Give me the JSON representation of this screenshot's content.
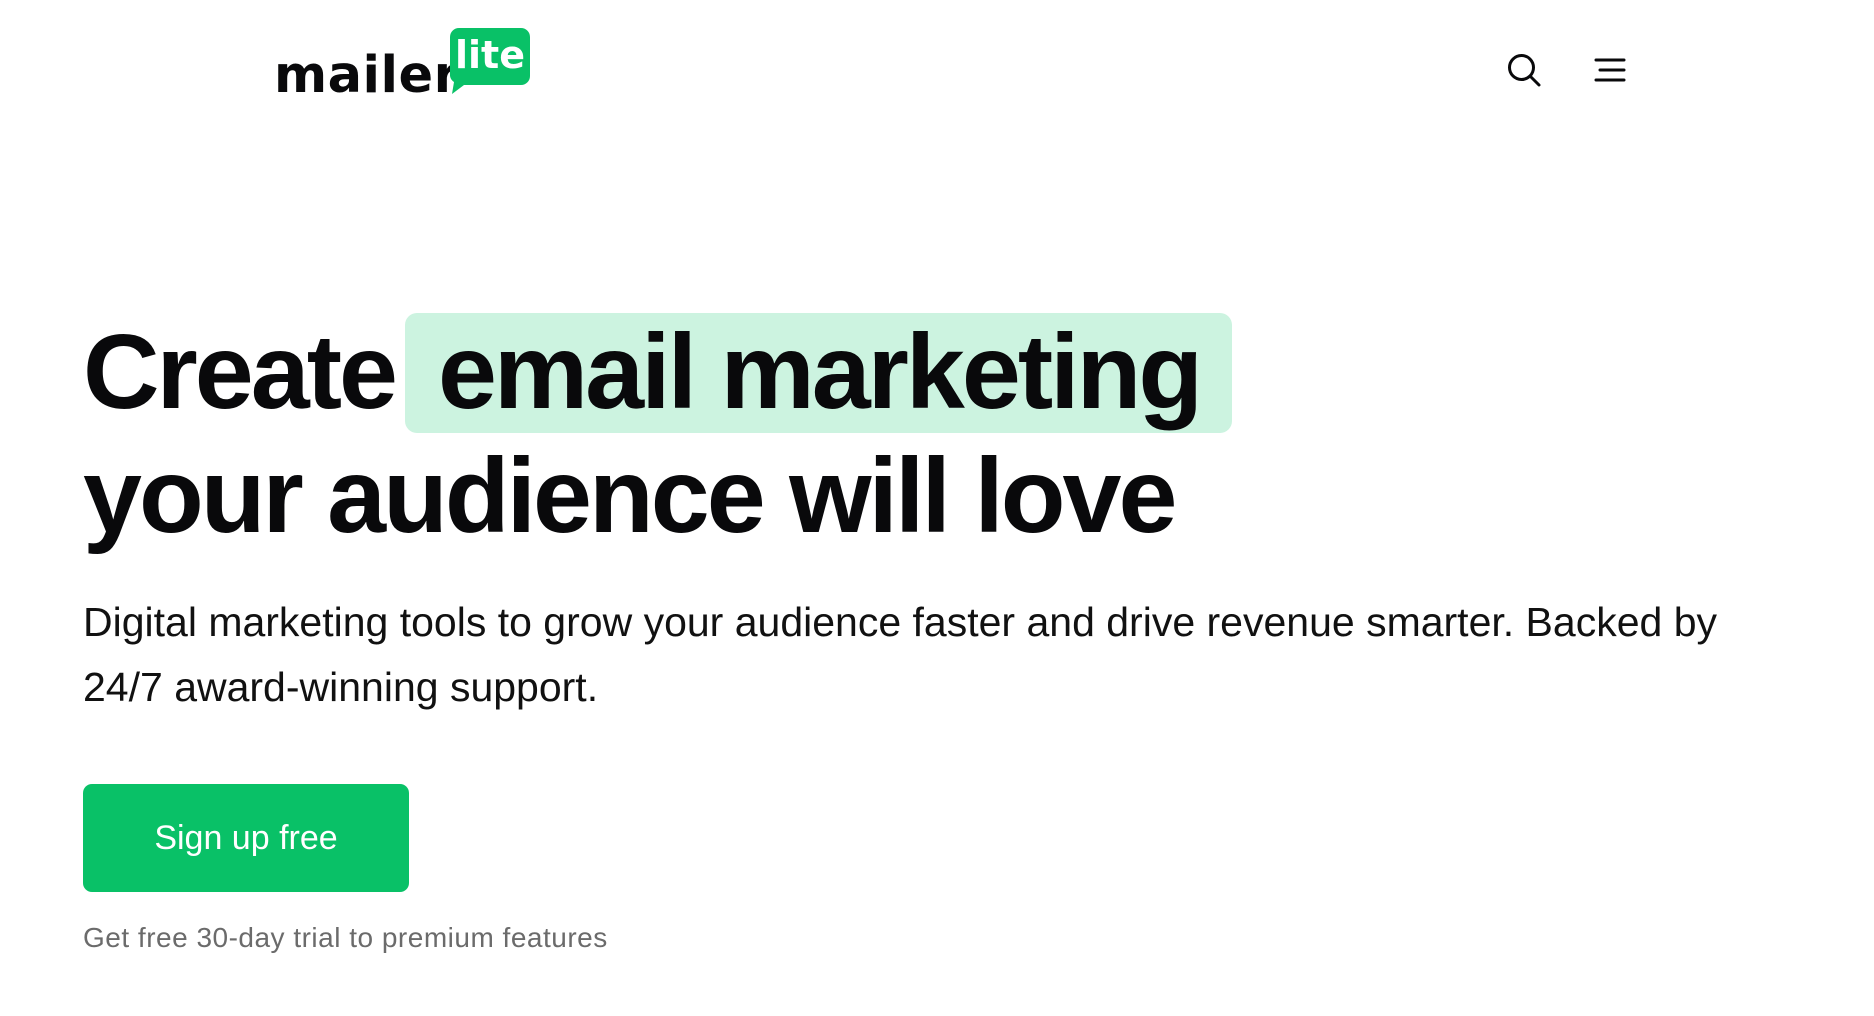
{
  "header": {
    "logo": {
      "word": "mailer",
      "badge": "lite",
      "badge_color": "#09c167"
    },
    "icons": {
      "search": "search-icon",
      "menu": "menu-icon"
    }
  },
  "hero": {
    "headline_part1": "Create",
    "headline_highlight": "email marketing",
    "headline_line2": "your audience will love",
    "highlight_color": "#ccf3e0",
    "subtitle_line1": "Digital marketing tools to grow your audience faster and drive revenue smarter. Backed by",
    "subtitle_line2": "24/7 award-winning support.",
    "cta_label": "Sign up free",
    "cta_color": "#09c167",
    "trial_note": "Get free 30-day trial to premium features"
  }
}
